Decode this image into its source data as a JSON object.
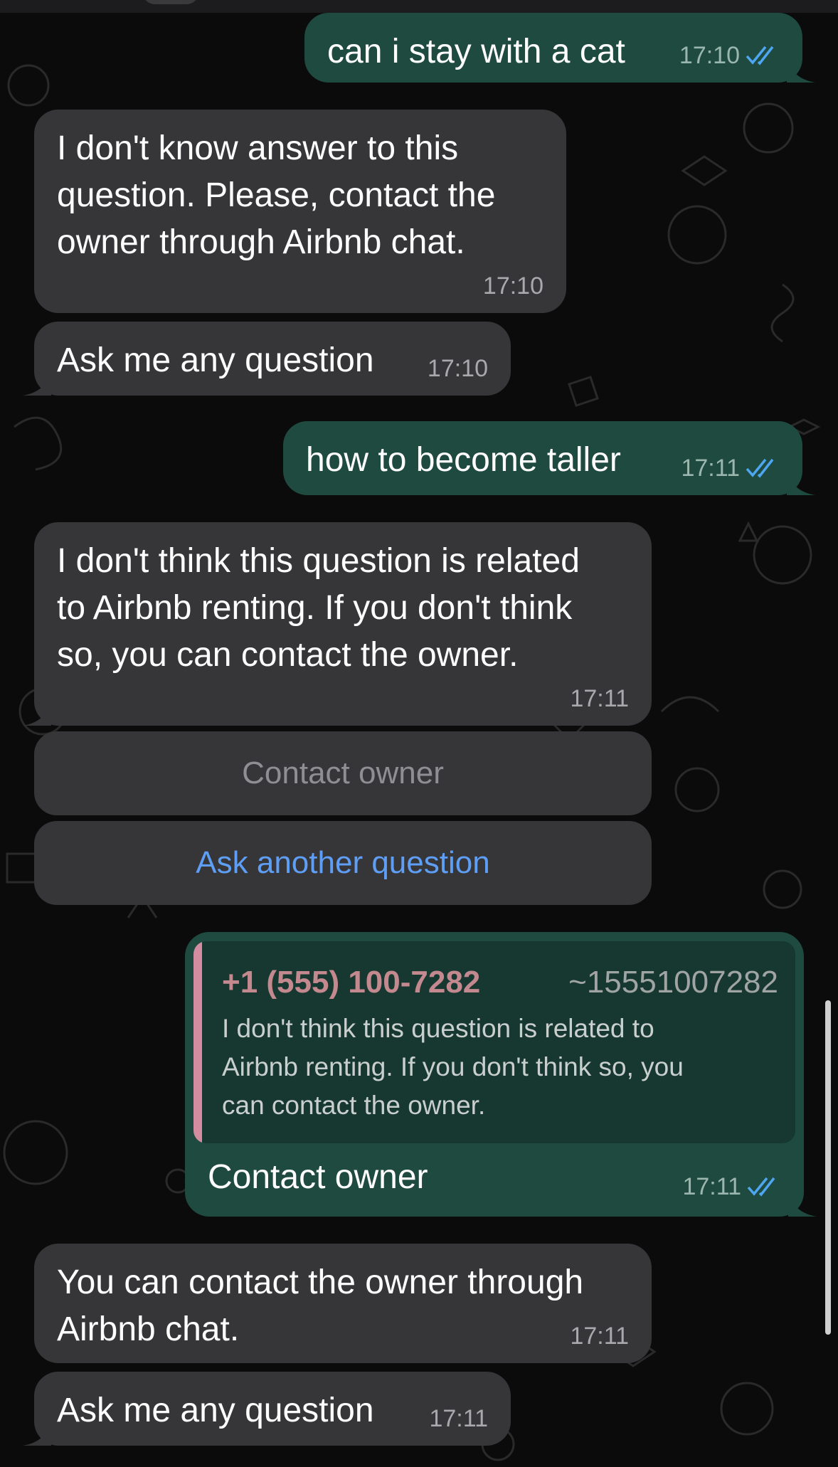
{
  "messages": [
    {
      "id": "m1",
      "direction": "out",
      "text": "can i stay with a cat",
      "time": "17:10",
      "read": true
    },
    {
      "id": "m2",
      "direction": "in",
      "text": "I don't know answer to this\nquestion. Please, contact the\nowner through Airbnb chat.",
      "time": "17:10"
    },
    {
      "id": "m3",
      "direction": "in",
      "text": "Ask me any question",
      "time": "17:10"
    },
    {
      "id": "m4",
      "direction": "out",
      "text": "how to become taller",
      "time": "17:11",
      "read": true
    },
    {
      "id": "m5",
      "direction": "in",
      "text": "I don't think this question is related\nto Airbnb renting. If you don't think\nso, you can contact the owner.",
      "time": "17:11"
    },
    {
      "id": "m6",
      "direction": "out",
      "text": "Contact owner",
      "time": "17:11",
      "read": true,
      "reply_to": {
        "name": "+1 (555) 100-7282",
        "handle": "~15551007282",
        "text": "I don't think this question is related to\nAirbnb renting. If you don't think so, you\ncan contact the owner."
      }
    },
    {
      "id": "m7",
      "direction": "in",
      "text": "You can contact the owner through\nAirbnb chat.",
      "time": "17:11"
    },
    {
      "id": "m8",
      "direction": "in",
      "text": "Ask me any question",
      "time": "17:11"
    }
  ],
  "keyboard": {
    "contact_owner": {
      "label": "Contact owner",
      "state": "disabled"
    },
    "ask_another": {
      "label": "Ask another question",
      "state": "active"
    }
  },
  "colors": {
    "background": "#0b0b0b",
    "incoming_bubble": "#363638",
    "outgoing_bubble": "#1f4a40",
    "read_ticks": "#4fa6f0",
    "link_blue": "#5e9ef5",
    "quote_accent": "#d48ca1"
  },
  "icons": {
    "read_status": "double-check-icon",
    "wallpaper": "doodle-pattern"
  }
}
